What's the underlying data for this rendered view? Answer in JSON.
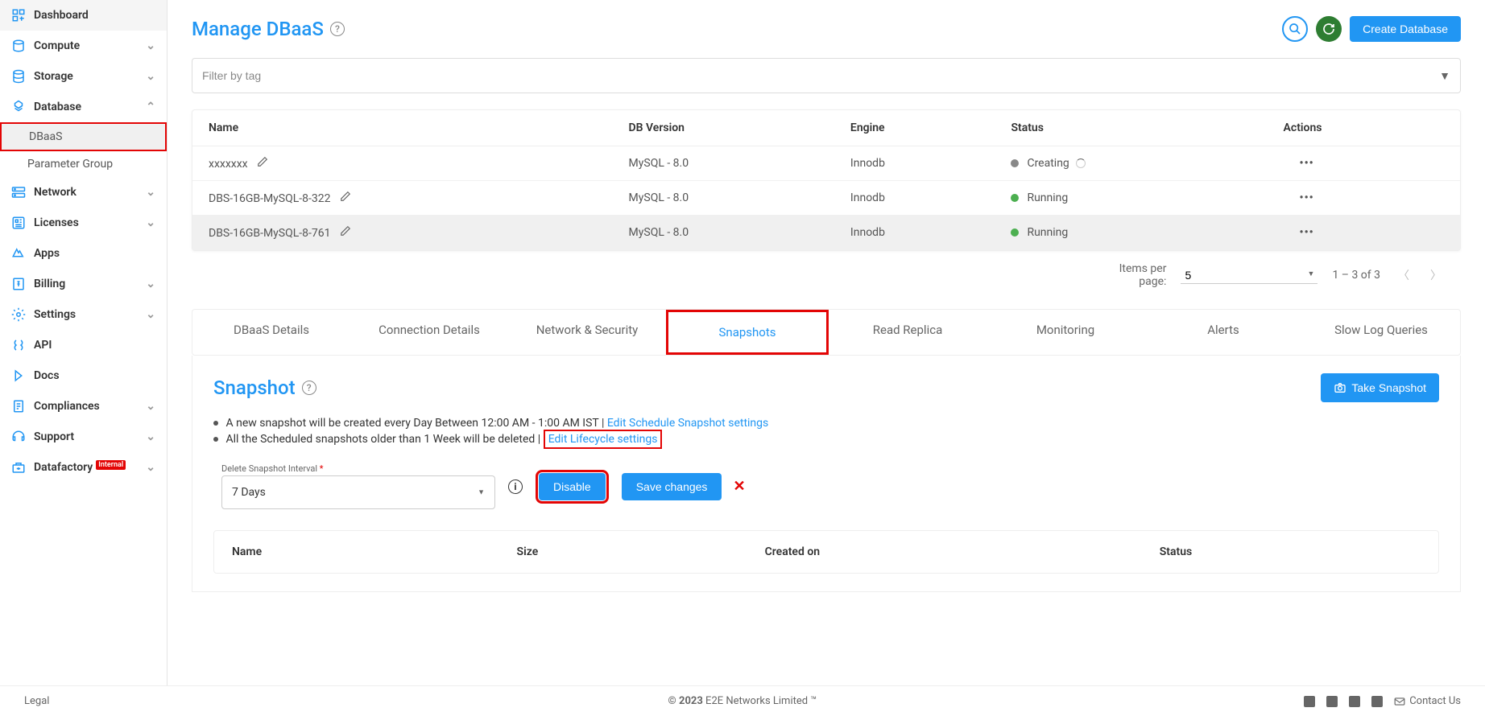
{
  "sidebar": {
    "items": [
      {
        "label": "Dashboard",
        "expandable": false
      },
      {
        "label": "Compute",
        "expandable": true
      },
      {
        "label": "Storage",
        "expandable": true
      },
      {
        "label": "Database",
        "expandable": true,
        "expanded": true,
        "children": [
          {
            "label": "DBaaS",
            "active": true
          },
          {
            "label": "Parameter Group",
            "active": false
          }
        ]
      },
      {
        "label": "Network",
        "expandable": true
      },
      {
        "label": "Licenses",
        "expandable": true
      },
      {
        "label": "Apps",
        "expandable": false
      },
      {
        "label": "Billing",
        "expandable": true
      },
      {
        "label": "Settings",
        "expandable": true
      },
      {
        "label": "API",
        "expandable": false
      },
      {
        "label": "Docs",
        "expandable": false
      },
      {
        "label": "Compliances",
        "expandable": true
      },
      {
        "label": "Support",
        "expandable": true
      },
      {
        "label": "Datafactory",
        "badge": "Internal",
        "expandable": true
      }
    ]
  },
  "header": {
    "title": "Manage DBaaS",
    "create_btn": "Create Database"
  },
  "filter": {
    "placeholder": "Filter by tag"
  },
  "db_table": {
    "columns": [
      "Name",
      "DB Version",
      "Engine",
      "Status",
      "Actions"
    ],
    "rows": [
      {
        "name": "xxxxxxx",
        "version": "MySQL - 8.0",
        "engine": "Innodb",
        "status": "Creating",
        "status_color": "gray",
        "loading": true
      },
      {
        "name": "DBS-16GB-MySQL-8-322",
        "version": "MySQL - 8.0",
        "engine": "Innodb",
        "status": "Running",
        "status_color": "green"
      },
      {
        "name": "DBS-16GB-MySQL-8-761",
        "version": "MySQL - 8.0",
        "engine": "Innodb",
        "status": "Running",
        "status_color": "green",
        "selected": true
      }
    ]
  },
  "pagination": {
    "items_per_page_label": "Items per page:",
    "items_per_page": "5",
    "range": "1 – 3 of 3"
  },
  "tabs": [
    "DBaaS Details",
    "Connection Details",
    "Network & Security",
    "Snapshots",
    "Read Replica",
    "Monitoring",
    "Alerts",
    "Slow Log Queries"
  ],
  "active_tab_index": 3,
  "snapshot_panel": {
    "title": "Snapshot",
    "take_btn": "Take Snapshot",
    "line1_pre": "A new snapshot will be created every Day Between 12:00 AM - 1:00 AM IST |",
    "line1_link": "Edit Schedule Snapshot settings",
    "line2_pre": "All the Scheduled snapshots older than 1 Week will be deleted |",
    "line2_link": "Edit Lifecycle settings",
    "interval_label": "Delete Snapshot Interval",
    "interval_value": "7 Days",
    "disable_btn": "Disable",
    "save_btn": "Save changes",
    "snap_columns": [
      "Name",
      "Size",
      "Created on",
      "Status"
    ]
  },
  "footer": {
    "legal": "Legal",
    "copyright_bold": "© 2023",
    "copyright_rest": " E2E Networks Limited ™",
    "contact": "Contact Us"
  }
}
